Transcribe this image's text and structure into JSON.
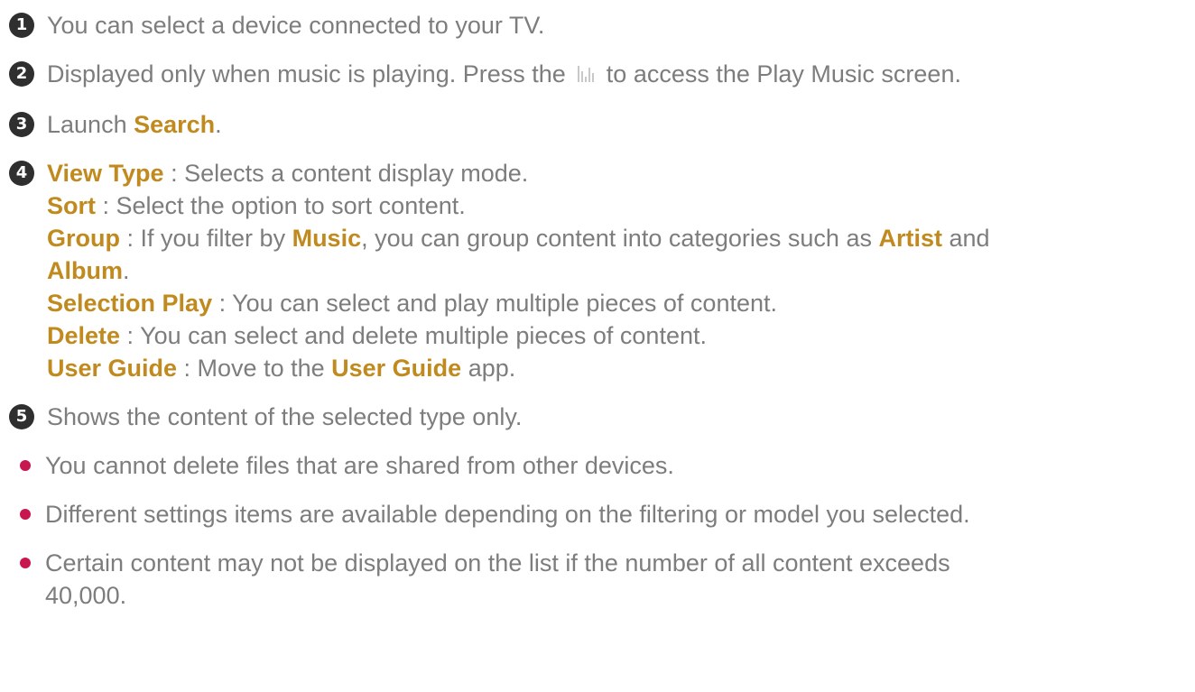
{
  "items": [
    {
      "number": "1",
      "text": "You can select a device connected to your TV."
    },
    {
      "number": "2",
      "before": "Displayed only when music is playing. Press the",
      "icon": "music-playing-icon",
      "after": "to access the Play Music screen."
    },
    {
      "number": "3",
      "prefix": "Launch ",
      "keyword": "Search",
      "suffix": "."
    },
    {
      "number": "4",
      "view_type": {
        "keyword": "View Type",
        "text": " : Selects a content display mode."
      },
      "sort": {
        "keyword": "Sort",
        "text": " : Select the option to sort content."
      },
      "group": {
        "keyword": "Group",
        "text1": " : If you filter by ",
        "kw_music": "Music",
        "text2": ", you can group content into categories such as ",
        "kw_artist": "Artist",
        "text3": " and ",
        "kw_album": "Album",
        "text4": "."
      },
      "selection_play": {
        "keyword": "Selection Play",
        "text": " : You can select and play multiple pieces of content."
      },
      "delete": {
        "keyword": "Delete",
        "text": " : You can select and delete multiple pieces of content."
      },
      "user_guide": {
        "keyword": "User Guide",
        "text1": " : Move to the ",
        "kw_app": "User Guide",
        "text2": " app."
      }
    },
    {
      "number": "5",
      "text": "Shows the content of the selected type only."
    }
  ],
  "notes": [
    "You cannot delete files that are shared from other devices.",
    "Different settings items are available depending on the filtering or model you selected.",
    "Certain content may not be displayed on the list if the number of all content exceeds 40,000."
  ],
  "colors": {
    "text": "#7d7d7d",
    "keyword": "#c08a1e",
    "number_badge": "#2f2f2f",
    "bullet_dot": "#c8174f"
  }
}
